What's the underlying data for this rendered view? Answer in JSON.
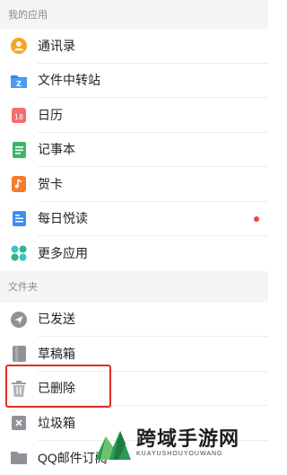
{
  "colors": {
    "header_bg": "#f5f5f5",
    "unread_dot": "#e8463f",
    "highlight_border": "#e22b24"
  },
  "sections": {
    "apps": {
      "title": "我的应用",
      "items": [
        {
          "label": "通讯录",
          "icon": "contacts-icon"
        },
        {
          "label": "文件中转站",
          "icon": "file-transfer-icon"
        },
        {
          "label": "日历",
          "icon": "calendar-icon",
          "icon_text": "18"
        },
        {
          "label": "记事本",
          "icon": "notepad-icon"
        },
        {
          "label": "贺卡",
          "icon": "greeting-card-icon"
        },
        {
          "label": "每日悦读",
          "icon": "daily-reading-icon",
          "unread": true
        },
        {
          "label": "更多应用",
          "icon": "more-apps-icon"
        }
      ]
    },
    "folders": {
      "title": "文件夹",
      "items": [
        {
          "label": "已发送",
          "icon": "sent-icon"
        },
        {
          "label": "草稿箱",
          "icon": "drafts-icon"
        },
        {
          "label": "已删除",
          "icon": "trash-icon",
          "highlighted": true
        },
        {
          "label": "垃圾箱",
          "icon": "spam-icon"
        },
        {
          "label": "QQ邮件订阅",
          "icon": "subscription-folder-icon"
        }
      ]
    }
  },
  "watermark": {
    "main_text": "跨域手游网",
    "sub_text": "KUAYUSHOUYOUWANG"
  }
}
